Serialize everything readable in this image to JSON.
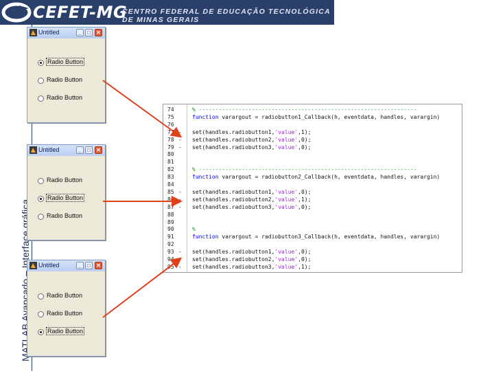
{
  "header": {
    "brand": "CEFET-MG",
    "subtitle": "CENTRO FEDERAL DE EDUCAÇÃO TECNOLÓGICA DE MINAS GERAIS"
  },
  "side_title": "MATLAB Avançado – Interface gráfica",
  "windows": [
    {
      "title": "Untitled",
      "radios": [
        "Radio Button",
        "Radio Button",
        "Radio Button"
      ],
      "selected": 1
    },
    {
      "title": "Untitled",
      "radios": [
        "Radio Button",
        "Radio Button",
        "Radio Button"
      ],
      "selected": 2
    },
    {
      "title": "Untitled",
      "radios": [
        "Radio Button",
        "Radio Button",
        "Radio Button"
      ],
      "selected": 3
    }
  ],
  "code": [
    {
      "n": "74",
      "m": "",
      "t": "% ------------------------------------------------------------------"
    },
    {
      "n": "75",
      "m": "",
      "t": "function varargout = radiobutton1_Callback(h, eventdata, handles, varargin)"
    },
    {
      "n": "76",
      "m": "",
      "t": ""
    },
    {
      "n": "77",
      "m": "-",
      "t": "set(handles.radiobutton1,'value',1);"
    },
    {
      "n": "78",
      "m": "-",
      "t": "set(handles.radiobutton2,'value',0);"
    },
    {
      "n": "79",
      "m": "-",
      "t": "set(handles.radiobutton3,'value',0);"
    },
    {
      "n": "80",
      "m": "",
      "t": ""
    },
    {
      "n": "81",
      "m": "",
      "t": ""
    },
    {
      "n": "82",
      "m": "",
      "t": "% ------------------------------------------------------------------"
    },
    {
      "n": "83",
      "m": "",
      "t": "function varargout = radiobutton2_Callback(h, eventdata, handles, varargin)"
    },
    {
      "n": "84",
      "m": "",
      "t": ""
    },
    {
      "n": "85",
      "m": "-",
      "t": "set(handles.radiobutton1,'value',0);"
    },
    {
      "n": "86",
      "m": "-",
      "t": "set(handles.radiobutton2,'value',1);"
    },
    {
      "n": "87",
      "m": "-",
      "t": "set(handles.radiobutton3,'value',0);"
    },
    {
      "n": "88",
      "m": "",
      "t": ""
    },
    {
      "n": "89",
      "m": "",
      "t": ""
    },
    {
      "n": "90",
      "m": "",
      "t": "%"
    },
    {
      "n": "91",
      "m": "",
      "t": "function varargout = radiobutton3_Callback(h, eventdata, handles, varargin)"
    },
    {
      "n": "92",
      "m": "",
      "t": ""
    },
    {
      "n": "93",
      "m": "-",
      "t": "set(handles.radiobutton1,'value',0);"
    },
    {
      "n": "94",
      "m": "-",
      "t": "set(handles.radiobutton2,'value',0);"
    },
    {
      "n": "95",
      "m": "-",
      "t": "set(handles.radiobutton3,'value',1);"
    }
  ],
  "colors": {
    "banner": "#2a3f6a",
    "arrow": "#e0401a",
    "comment": "#228b22",
    "keyword": "#0000ee",
    "string": "#a020f0"
  },
  "icons": {
    "window_app": "matlab-figure-icon",
    "minimize": "minimize-icon",
    "maximize": "maximize-icon",
    "close": "close-icon"
  }
}
